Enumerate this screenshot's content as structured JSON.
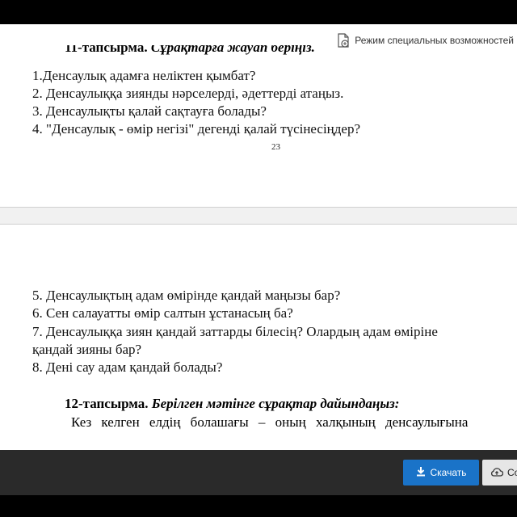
{
  "toolbar": {
    "accessibility_label": "Режим специальных возможностей"
  },
  "page1": {
    "cutoff_task_number": "11-тапсырма.",
    "cutoff_task_text": "Сұрақтарға жауап беріңіз.",
    "questions": [
      "1.Денсаулық адамға неліктен қымбат?",
      "2. Денсаулыққа зиянды нәрселерді, әдеттерді атаңыз.",
      "3. Денсаулықты қалай сақтауға болады?",
      "4. \"Денсаулық - өмір негізі\" дегенді қалай түсінесіңдер?"
    ],
    "page_number": "23"
  },
  "page2": {
    "questions": [
      "5. Денсаулықтың адам өмірінде қандай маңызы бар?",
      "6. Сен салауатты өмір салтын ұстанасың ба?",
      "7. Денсаулыққа зиян қандай заттарды білесің? Олардың адам өміріне",
      "қандай зияны бар?",
      "8. Дені сау адам қандай болады?"
    ],
    "task12_number": "12-тапсырма.",
    "task12_text": "Берілген мәтінге сұрақтар дайындаңыз:",
    "body_text": "Кез келген елдің болашағы – оның халқының денсаулығына"
  },
  "bottom_bar": {
    "download_label": "Скачать",
    "save_label": "Со"
  }
}
